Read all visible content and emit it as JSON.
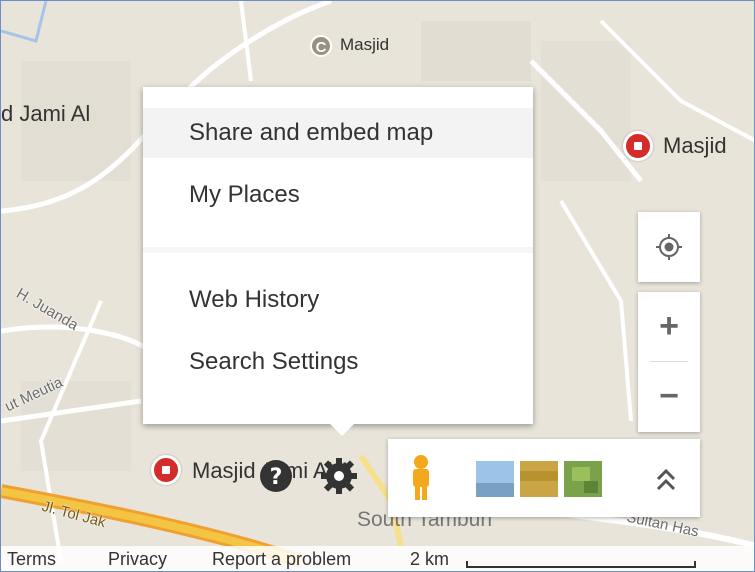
{
  "map": {
    "labels": {
      "masjid_top": "Masjid",
      "jami_left": "d Jami Al",
      "masjid_right": "Masjid",
      "masjid_bottom": "Masjid Jami Al A",
      "south": "South Tambun"
    },
    "streets": {
      "juanda": "H. Juanda",
      "meutia": "ut Meutia",
      "tol": "Jl. Tol Jak",
      "sultan": "Sultan Has"
    },
    "colors": {
      "pin": "#d52b2b",
      "road_yellow": "#f4c542",
      "road_orange": "#f0a030"
    }
  },
  "menu": {
    "items": [
      {
        "label": "Share and embed map",
        "hover": true
      },
      {
        "label": "My Places"
      },
      {
        "label": "Web History"
      },
      {
        "label": "Search Settings"
      }
    ]
  },
  "controls": {
    "locate_icon": "target-icon",
    "zoom_in": "+",
    "zoom_out": "−",
    "pegman_icon": "pegman-icon",
    "expand_icon": "chevron-up-icon",
    "expand": "⌃"
  },
  "footer": {
    "terms": "Terms",
    "privacy": "Privacy",
    "report": "Report a problem",
    "scale": "2 km"
  }
}
